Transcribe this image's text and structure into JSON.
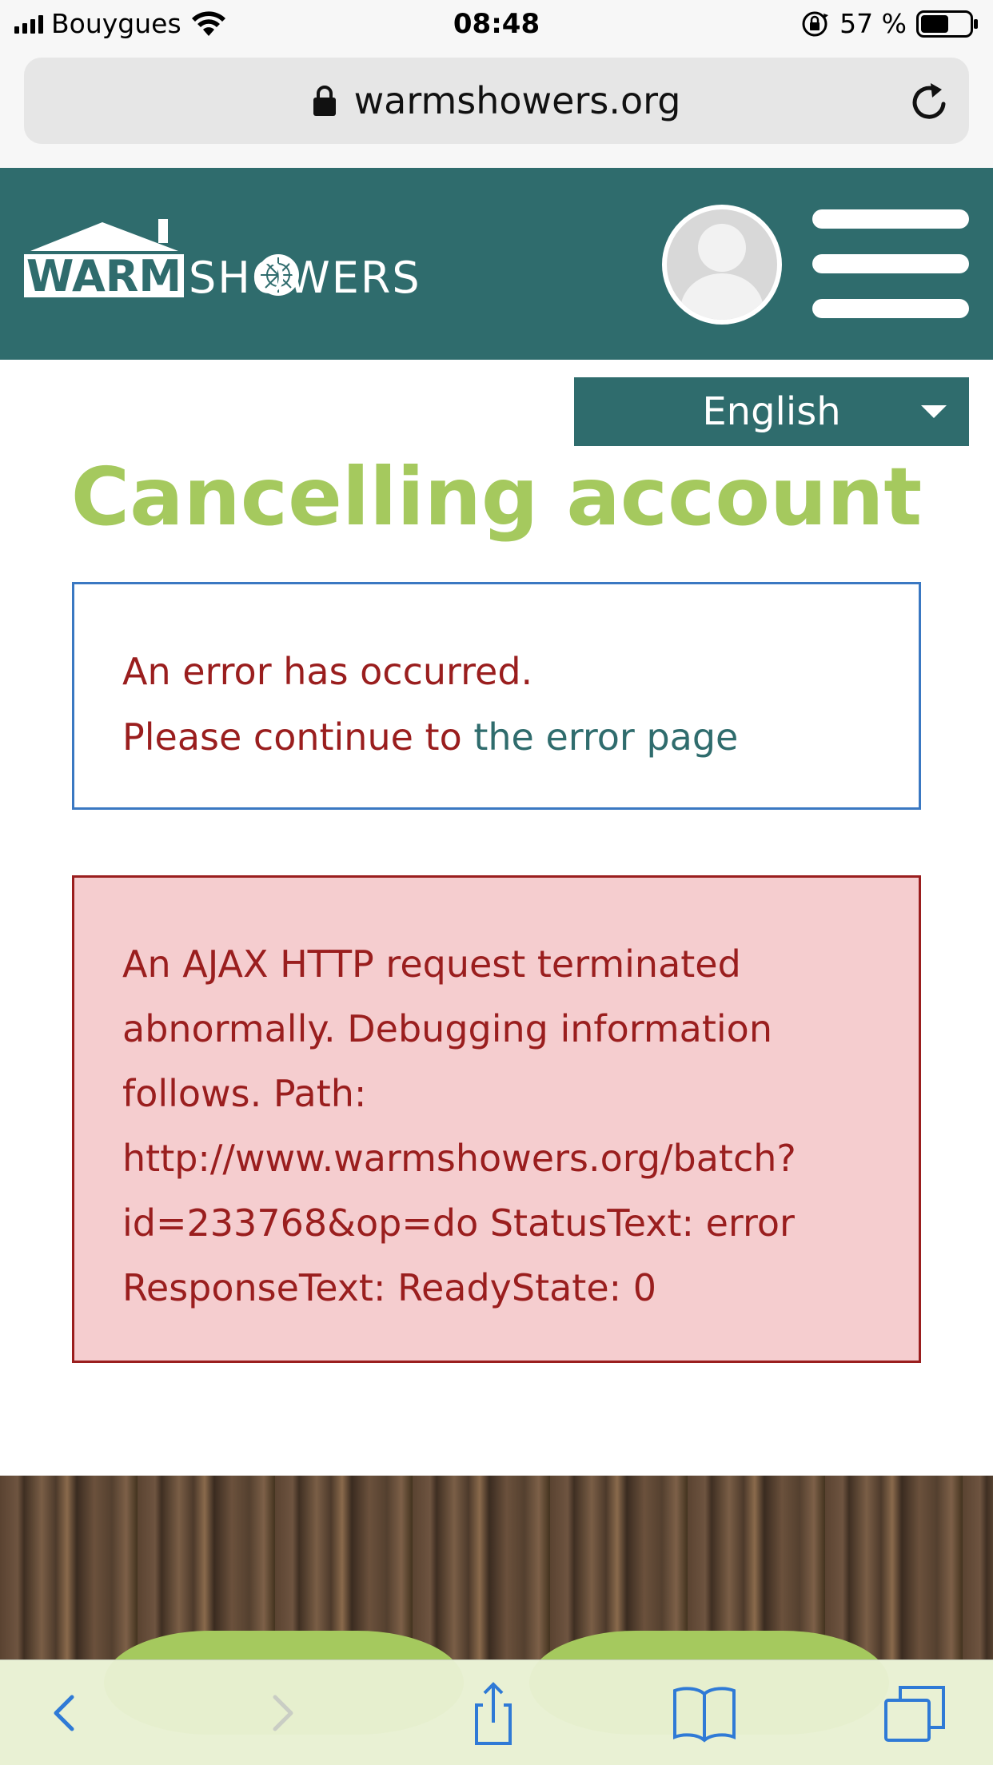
{
  "status_bar": {
    "carrier": "Bouygues",
    "time": "08:48",
    "battery_percent": "57 %",
    "battery_level": 0.57
  },
  "browser": {
    "url": "warmshowers.org"
  },
  "header": {
    "logo_text_part1": "WARM",
    "logo_text_part2": "SHOWERS",
    "colors": {
      "header_bg": "#2f6c6d",
      "accent_green": "#a5c95e"
    }
  },
  "language_select": {
    "selected": "English"
  },
  "page": {
    "title": "Cancelling account",
    "error_line1": "An error has occurred.",
    "error_line2_prefix": "Please continue to ",
    "error_link": "the error page",
    "ajax_message": "An AJAX HTTP request terminated abnormally. Debugging information follows. Path: http://www.warmshowers.org/batch?id=233768&op=do StatusText: error ResponseText: ReadyState: 0"
  },
  "toolbar": {
    "icons": [
      "back-icon",
      "forward-icon",
      "share-icon",
      "bookmarks-icon",
      "tabs-icon"
    ]
  }
}
